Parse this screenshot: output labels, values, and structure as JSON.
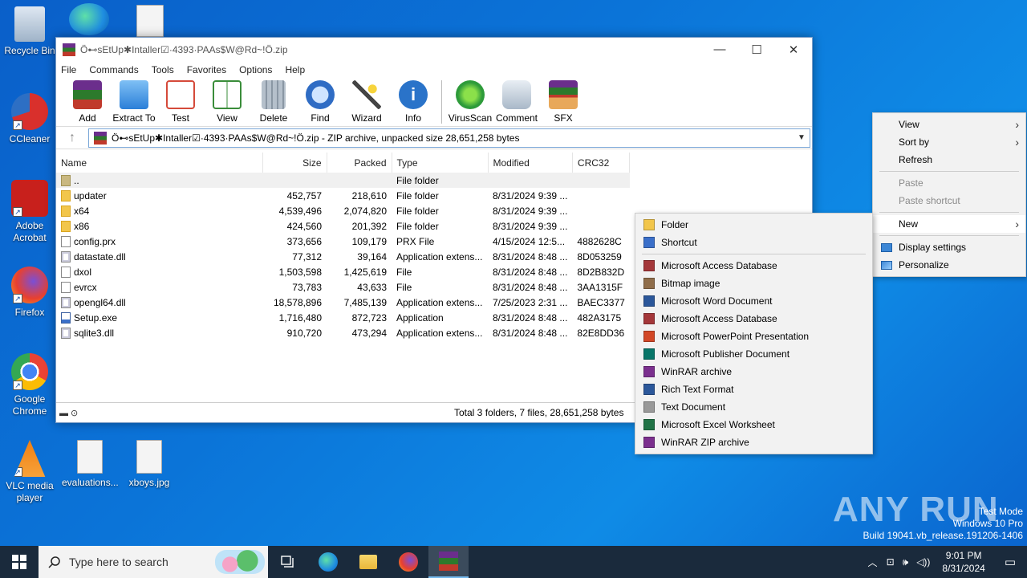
{
  "desktop": {
    "icons": [
      {
        "label": "Recycle Bin"
      },
      {
        "label": "CCleaner"
      },
      {
        "label": "Adobe Acrobat"
      },
      {
        "label": "Firefox"
      },
      {
        "label": "Google Chrome"
      },
      {
        "label": "VLC media player"
      },
      {
        "label": "evaluations..."
      },
      {
        "label": "xboys.jpg"
      }
    ]
  },
  "window": {
    "title": "Ö⊷sEtUp✱Intaller☑·4393·PAAs$W@Rd~!Ö.zip",
    "controls": {
      "minimize": "—",
      "maximize": "☐",
      "close": "✕"
    },
    "menu": [
      "File",
      "Commands",
      "Tools",
      "Favorites",
      "Options",
      "Help"
    ],
    "toolbar": [
      {
        "label": "Add",
        "icon": "add-icon",
        "color": "#b8362e"
      },
      {
        "label": "Extract To",
        "icon": "extract-icon",
        "color": "#3c8de0"
      },
      {
        "label": "Test",
        "icon": "test-icon",
        "color": "#d54a3a"
      },
      {
        "label": "View",
        "icon": "view-icon",
        "color": "#3a8d3a"
      },
      {
        "label": "Delete",
        "icon": "delete-icon",
        "color": "#9aa6b2"
      },
      {
        "label": "Find",
        "icon": "find-icon",
        "color": "#2f6cc4"
      },
      {
        "label": "Wizard",
        "icon": "wizard-icon",
        "color": "#7a58b0"
      },
      {
        "label": "Info",
        "icon": "info-icon",
        "color": "#2a73c9"
      },
      {
        "label": "VirusScan",
        "icon": "virusscan-icon",
        "color": "#2e9b3a"
      },
      {
        "label": "Comment",
        "icon": "comment-icon",
        "color": "#8aa0b6"
      },
      {
        "label": "SFX",
        "icon": "sfx-icon",
        "color": "#c9733a"
      }
    ],
    "path": "Ö⊷sEtUp✱Intaller☑·4393·PAAs$W@Rd~!Ö.zip - ZIP archive, unpacked size 28,651,258 bytes",
    "columns": [
      "Name",
      "Size",
      "Packed",
      "Type",
      "Modified",
      "CRC32"
    ],
    "files": [
      {
        "name": "..",
        "size": "",
        "packed": "",
        "type": "File folder",
        "modified": "",
        "crc": "",
        "kind": "parent"
      },
      {
        "name": "updater",
        "size": "452,757",
        "packed": "218,610",
        "type": "File folder",
        "modified": "8/31/2024 9:39 ...",
        "crc": "",
        "kind": "folder"
      },
      {
        "name": "x64",
        "size": "4,539,496",
        "packed": "2,074,820",
        "type": "File folder",
        "modified": "8/31/2024 9:39 ...",
        "crc": "",
        "kind": "folder"
      },
      {
        "name": "x86",
        "size": "424,560",
        "packed": "201,392",
        "type": "File folder",
        "modified": "8/31/2024 9:39 ...",
        "crc": "",
        "kind": "folder"
      },
      {
        "name": "config.prx",
        "size": "373,656",
        "packed": "109,179",
        "type": "PRX File",
        "modified": "4/15/2024 12:5...",
        "crc": "4882628C",
        "kind": "doc"
      },
      {
        "name": "datastate.dll",
        "size": "77,312",
        "packed": "39,164",
        "type": "Application extens...",
        "modified": "8/31/2024 8:48 ...",
        "crc": "8D053259",
        "kind": "dll"
      },
      {
        "name": "dxol",
        "size": "1,503,598",
        "packed": "1,425,619",
        "type": "File",
        "modified": "8/31/2024 8:48 ...",
        "crc": "8D2B832D",
        "kind": "doc"
      },
      {
        "name": "evrcx",
        "size": "73,783",
        "packed": "43,633",
        "type": "File",
        "modified": "8/31/2024 8:48 ...",
        "crc": "3AA1315F",
        "kind": "doc"
      },
      {
        "name": "opengl64.dll",
        "size": "18,578,896",
        "packed": "7,485,139",
        "type": "Application extens...",
        "modified": "7/25/2023 2:31 ...",
        "crc": "BAEC3377",
        "kind": "dll"
      },
      {
        "name": "Setup.exe",
        "size": "1,716,480",
        "packed": "872,723",
        "type": "Application",
        "modified": "8/31/2024 8:48 ...",
        "crc": "482A3175",
        "kind": "exe"
      },
      {
        "name": "sqlite3.dll",
        "size": "910,720",
        "packed": "473,294",
        "type": "Application extens...",
        "modified": "8/31/2024 8:48 ...",
        "crc": "82E8DD36",
        "kind": "dll"
      }
    ],
    "status": "Total 3 folders, 7 files, 28,651,258 bytes"
  },
  "context_menu": {
    "items": [
      {
        "label": "View",
        "submenu": true,
        "disabled": false
      },
      {
        "label": "Sort by",
        "submenu": true,
        "disabled": false
      },
      {
        "label": "Refresh",
        "submenu": false,
        "disabled": false
      },
      {
        "label": "Paste",
        "submenu": false,
        "disabled": true
      },
      {
        "label": "Paste shortcut",
        "submenu": false,
        "disabled": true
      },
      {
        "label": "New",
        "submenu": true,
        "disabled": false
      },
      {
        "label": "Display settings",
        "submenu": false,
        "disabled": false
      },
      {
        "label": "Personalize",
        "submenu": false,
        "disabled": false
      }
    ]
  },
  "new_menu": {
    "items": [
      {
        "label": "Folder",
        "color": "#f2c64b"
      },
      {
        "label": "Shortcut",
        "color": "#3a6fc9"
      },
      {
        "label": "Microsoft Access Database",
        "color": "#a4373a"
      },
      {
        "label": "Bitmap image",
        "color": "#8f6d4a"
      },
      {
        "label": "Microsoft Word Document",
        "color": "#2b579a"
      },
      {
        "label": "Microsoft Access Database",
        "color": "#a4373a"
      },
      {
        "label": "Microsoft PowerPoint Presentation",
        "color": "#d24726"
      },
      {
        "label": "Microsoft Publisher Document",
        "color": "#077568"
      },
      {
        "label": "WinRAR archive",
        "color": "#7b2f8e"
      },
      {
        "label": "Rich Text Format",
        "color": "#2b579a"
      },
      {
        "label": "Text Document",
        "color": "#999999"
      },
      {
        "label": "Microsoft Excel Worksheet",
        "color": "#217346"
      },
      {
        "label": "WinRAR ZIP archive",
        "color": "#7b2f8e"
      }
    ]
  },
  "taskbar": {
    "search_placeholder": "Type here to search",
    "time": "9:01 PM",
    "date": "8/31/2024"
  },
  "watermark": {
    "brand": "ANY RUN",
    "line1": "Test Mode",
    "line2": "Windows 10 Pro",
    "line3": "Build 19041.vb_release.191206-1406"
  }
}
